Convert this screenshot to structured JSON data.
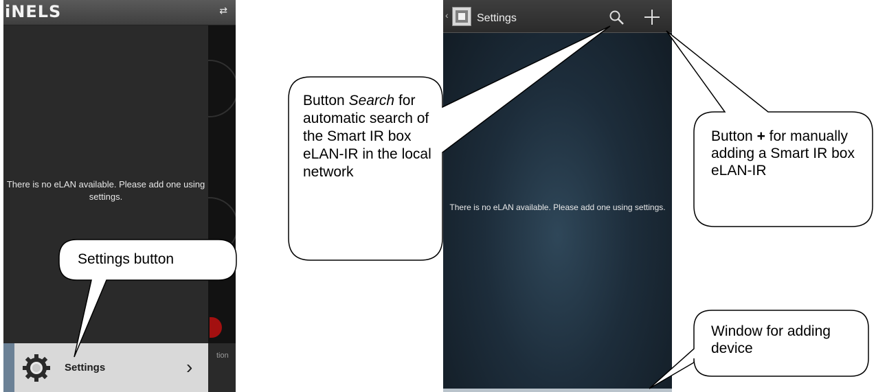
{
  "left_phone": {
    "logo": "iNELS",
    "empty_message": "There is no eLAN available. Please add one using settings.",
    "settings_item": {
      "label": "Settings",
      "chevron": "›",
      "icon": "gear-icon"
    },
    "station_tab_text": "tion",
    "sync_icon": "⇄"
  },
  "right_phone": {
    "title": "Settings",
    "back_chevron": "‹",
    "empty_message": "There is no eLAN available. Please add one using settings.",
    "search_icon": "search-icon",
    "add_icon": "plus-icon"
  },
  "callouts": {
    "search": {
      "line1_prefix": "Button ",
      "line1_italic": "Search",
      "rest": "for automatic search of the Smart IR box eLAN-IR in the local network"
    },
    "plus": {
      "prefix": "Button ",
      "bold": "+",
      "rest": " for manually adding a Smart IR box eLAN-IR"
    },
    "settings": {
      "text": "Settings button"
    },
    "window": {
      "text": "Window for adding device"
    }
  },
  "colors": {
    "left_drawer": "#2a2a2a",
    "settings_row": "#d9d9d9",
    "right_bg": "#1d2d3b",
    "accent_red": "#a31010"
  }
}
